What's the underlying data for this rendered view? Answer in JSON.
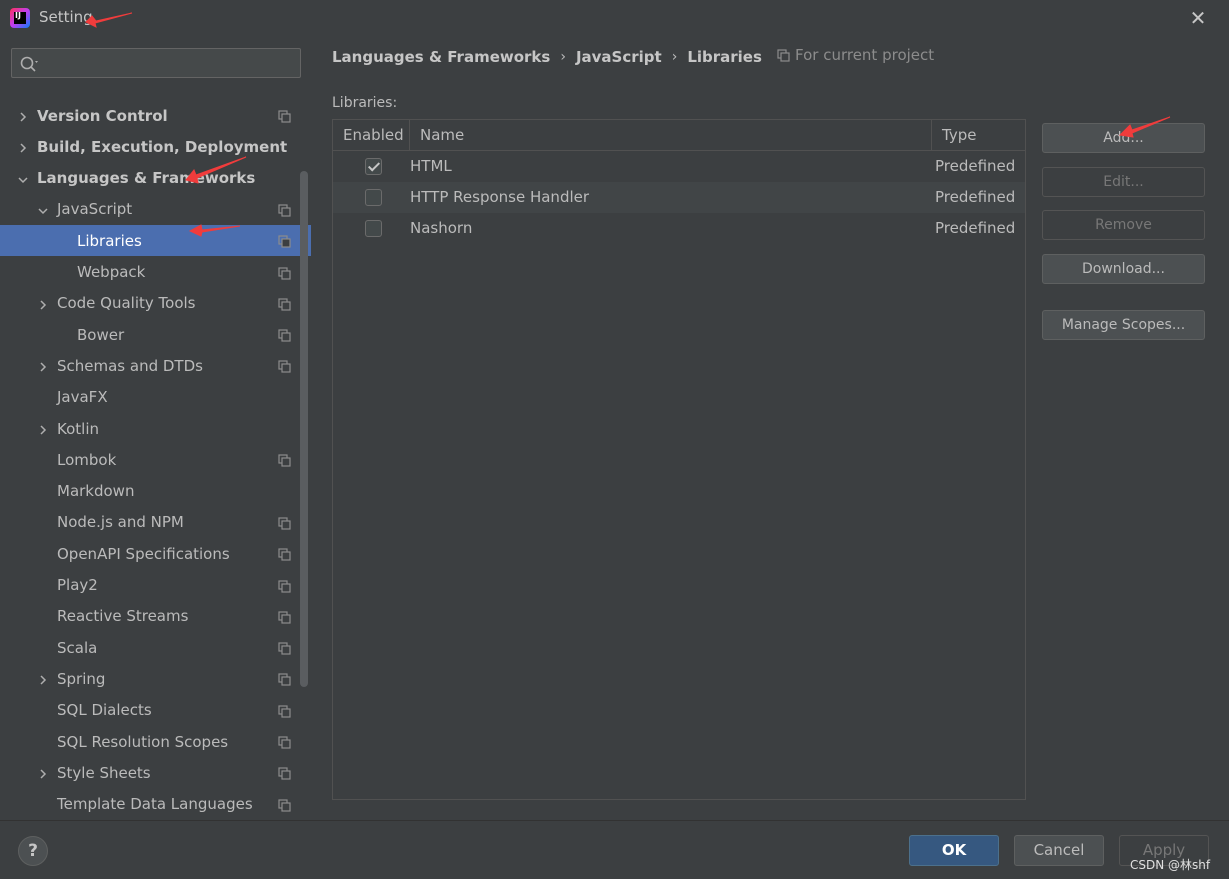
{
  "window": {
    "title": "Setting",
    "close_glyph": "✕"
  },
  "search": {
    "placeholder": "",
    "value": ""
  },
  "sidebar": {
    "items": [
      {
        "label": "Version Control",
        "bold": true,
        "expander": "collapsed",
        "icon": true
      },
      {
        "label": "Build, Execution, Deployment",
        "bold": true,
        "expander": "collapsed",
        "icon": false
      },
      {
        "label": "Languages & Frameworks",
        "bold": true,
        "expander": "expanded",
        "icon": false
      },
      {
        "label": "JavaScript",
        "bold": false,
        "expander": "expanded",
        "icon": true
      },
      {
        "label": "Libraries",
        "bold": false,
        "expander": "none",
        "icon": true,
        "selected": true
      },
      {
        "label": "Webpack",
        "bold": false,
        "expander": "none",
        "icon": true
      },
      {
        "label": "Code Quality Tools",
        "bold": false,
        "expander": "collapsed",
        "icon": true
      },
      {
        "label": "Bower",
        "bold": false,
        "expander": "none",
        "icon": true
      },
      {
        "label": "Schemas and DTDs",
        "bold": false,
        "expander": "collapsed",
        "icon": true
      },
      {
        "label": "JavaFX",
        "bold": false,
        "expander": "none",
        "icon": false
      },
      {
        "label": "Kotlin",
        "bold": false,
        "expander": "collapsed",
        "icon": false
      },
      {
        "label": "Lombok",
        "bold": false,
        "expander": "none",
        "icon": true
      },
      {
        "label": "Markdown",
        "bold": false,
        "expander": "none",
        "icon": false
      },
      {
        "label": "Node.js and NPM",
        "bold": false,
        "expander": "none",
        "icon": true
      },
      {
        "label": "OpenAPI Specifications",
        "bold": false,
        "expander": "none",
        "icon": true
      },
      {
        "label": "Play2",
        "bold": false,
        "expander": "none",
        "icon": true
      },
      {
        "label": "Reactive Streams",
        "bold": false,
        "expander": "none",
        "icon": true
      },
      {
        "label": "Scala",
        "bold": false,
        "expander": "none",
        "icon": true
      },
      {
        "label": "Spring",
        "bold": false,
        "expander": "collapsed",
        "icon": true
      },
      {
        "label": "SQL Dialects",
        "bold": false,
        "expander": "none",
        "icon": true
      },
      {
        "label": "SQL Resolution Scopes",
        "bold": false,
        "expander": "none",
        "icon": true
      },
      {
        "label": "Style Sheets",
        "bold": false,
        "expander": "collapsed",
        "icon": true
      },
      {
        "label": "Template Data Languages",
        "bold": false,
        "expander": "none",
        "icon": true
      }
    ]
  },
  "breadcrumb": {
    "items": [
      "Languages & Frameworks",
      "JavaScript",
      "Libraries"
    ],
    "separator": "›",
    "scope_hint": "For current project"
  },
  "libraries": {
    "label": "Libraries:",
    "columns": [
      "Enabled",
      "Name",
      "Type"
    ],
    "rows": [
      {
        "enabled": true,
        "name": "HTML",
        "type": "Predefined"
      },
      {
        "enabled": false,
        "name": "HTTP Response Handler",
        "type": "Predefined"
      },
      {
        "enabled": false,
        "name": "Nashorn",
        "type": "Predefined"
      }
    ]
  },
  "buttons": {
    "add": "Add...",
    "edit": "Edit...",
    "remove": "Remove",
    "download": "Download...",
    "manage_scopes": "Manage Scopes..."
  },
  "footer": {
    "help": "?",
    "ok": "OK",
    "cancel": "Cancel",
    "apply": "Apply",
    "watermark": "CSDN @林shf"
  },
  "colors": {
    "background": "#3c3f41",
    "selection": "#4b6eaf",
    "ok_button": "#365880",
    "annotation_arrow": "#f03c3c"
  }
}
